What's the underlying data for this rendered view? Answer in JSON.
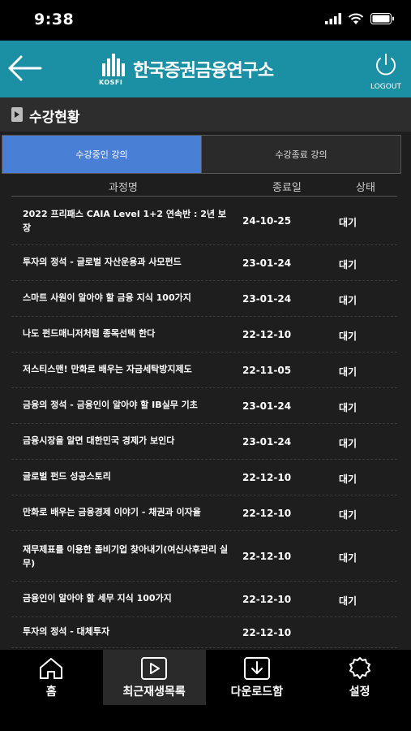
{
  "status_bar": {
    "time": "9:38"
  },
  "header": {
    "logo_mark": "KOSFI",
    "logo_text": "한국증권금융연구소",
    "logout_label": "LOGOUT"
  },
  "section": {
    "title": "수강현황"
  },
  "tabs": [
    {
      "label": "수강중인 강의",
      "active": true
    },
    {
      "label": "수강종료 강의",
      "active": false
    }
  ],
  "columns": {
    "name": "과정명",
    "end_date": "종료일",
    "status": "상태"
  },
  "courses": [
    {
      "title": "2022 프리패스 CAIA Level 1+2 연속반 : 2년 보장",
      "end_date": "24-10-25",
      "status": "대기"
    },
    {
      "title": "투자의 정석 - 글로벌 자산운용과 사모펀드",
      "end_date": "23-01-24",
      "status": "대기"
    },
    {
      "title": "스마트 사원이 알아야 할 금융 지식 100가지",
      "end_date": "23-01-24",
      "status": "대기"
    },
    {
      "title": "나도 펀드매니저처럼 종목선택 한다",
      "end_date": "22-12-10",
      "status": "대기"
    },
    {
      "title": "저스티스맨! 만화로 배우는 자금세탁방지제도",
      "end_date": "22-11-05",
      "status": "대기"
    },
    {
      "title": "금융의 정석 - 금융인이 알아야 할 IB실무 기초",
      "end_date": "23-01-24",
      "status": "대기"
    },
    {
      "title": "금융시장을 알면 대한민국 경제가 보인다",
      "end_date": "23-01-24",
      "status": "대기"
    },
    {
      "title": "글로벌 펀드 성공스토리",
      "end_date": "22-12-10",
      "status": "대기"
    },
    {
      "title": "만화로 배우는 금융경제 이야기 - 채권과 이자율",
      "end_date": "22-12-10",
      "status": "대기"
    },
    {
      "title": "재무제표를 이용한 좀비기업 찾아내기(여신사후관리 실무)",
      "end_date": "22-12-10",
      "status": "대기"
    },
    {
      "title": "금융인이 알아야 할 세무 지식 100가지",
      "end_date": "22-12-10",
      "status": "대기"
    },
    {
      "title": "투자의 정석 - 대체투자",
      "end_date": "22-12-10",
      "status": ""
    }
  ],
  "bottom_nav": [
    {
      "label": "홈",
      "icon": "home-icon",
      "active": false
    },
    {
      "label": "최근재생목록",
      "icon": "play-icon",
      "active": true
    },
    {
      "label": "다운로드함",
      "icon": "download-icon",
      "active": false
    },
    {
      "label": "설정",
      "icon": "gear-icon",
      "active": false
    }
  ]
}
